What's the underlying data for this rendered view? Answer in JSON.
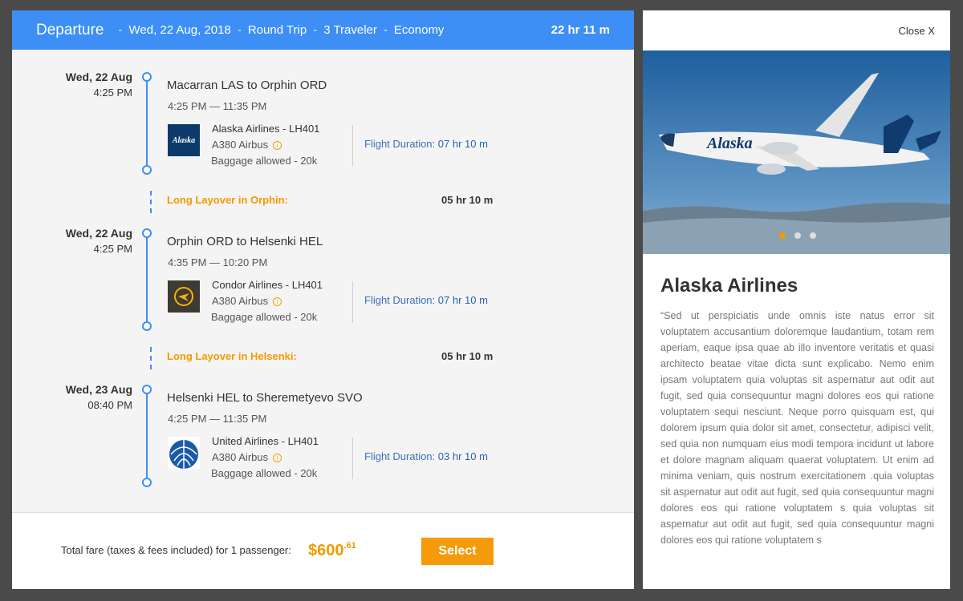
{
  "header": {
    "title": "Departure",
    "date": "Wed, 22 Aug, 2018",
    "trip_type": "Round Trip",
    "travelers": "3 Traveler",
    "cabin": "Economy",
    "total_duration": "22 hr 11 m",
    "separator": "-"
  },
  "segments": [
    {
      "date": "Wed, 22 Aug",
      "time": "4:25 PM",
      "route": "Macarran LAS to Orphin ORD",
      "times": "4:25 PM — 11:35 PM",
      "airline": "Alaska Airlines - LH401",
      "aircraft": "A380 Airbus",
      "baggage": "Baggage allowed  -  20k",
      "duration_label": "Flight Duration:",
      "duration_value": "07 hr 10 m",
      "logo": "alaska-logo-icon"
    },
    {
      "date": "Wed, 22 Aug",
      "time": "4:25 PM",
      "route": "Orphin ORD to Helsenki HEL",
      "times": "4:35 PM — 10:20 PM",
      "airline": "Condor Airlines - LH401",
      "aircraft": "A380 Airbus",
      "baggage": "Baggage allowed  -  20k",
      "duration_label": "Flight Duration:",
      "duration_value": "07 hr 10 m",
      "logo": "condor-logo-icon"
    },
    {
      "date": "Wed, 23 Aug",
      "time": "08:40 PM",
      "route": "Helsenki HEL to Sheremetyevo SVO",
      "times": "4:25 PM — 11:35 PM",
      "airline": "United Airlines - LH401",
      "aircraft": "A380 Airbus",
      "baggage": "Baggage allowed  -  20k",
      "duration_label": "Flight Duration:",
      "duration_value": "03 hr 10 m",
      "logo": "united-logo-icon"
    }
  ],
  "layovers": [
    {
      "label": "Long Layover in Orphin:",
      "time": "05 hr 10 m"
    },
    {
      "label": "Long Layover in Helsenki:",
      "time": "05 hr 10 m"
    }
  ],
  "footer": {
    "fare_label": "Total fare (taxes & fees included) for 1 passenger:",
    "fare_whole": "$600",
    "fare_cents": ".61",
    "select_label": "Select"
  },
  "detail": {
    "close_label": "Close X",
    "airline_title": "Alaska Airlines",
    "logo_text": "Alaska",
    "carousel_index": 1,
    "carousel_count": 3,
    "description": "“Sed ut perspiciatis unde omnis iste natus error sit voluptatem accusantium doloremque laudantium, totam rem aperiam, eaque ipsa quae ab illo inventore veritatis et quasi architecto beatae vitae dicta sunt explicabo. Nemo enim ipsam voluptatem quia voluptas sit aspernatur aut odit aut fugit, sed quia consequuntur magni dolores eos qui ratione voluptatem sequi nesciunt. Neque porro quisquam est, qui dolorem ipsum quia dolor sit amet, consectetur, adipisci velit, sed quia non numquam eius modi tempora incidunt ut labore et dolore magnam aliquam quaerat voluptatem. Ut enim ad minima veniam, quis nostrum exercitationem .quia voluptas sit aspernatur aut odit aut fugit, sed quia consequuntur magni dolores eos qui ratione voluptatem s quia voluptas sit aspernatur aut odit aut fugit, sed quia consequuntur magni dolores eos qui ratione voluptatem s"
  },
  "colors": {
    "accent": "#3d8ef5",
    "orange": "#f59a0a",
    "duration_blue": "#2a62b0"
  }
}
